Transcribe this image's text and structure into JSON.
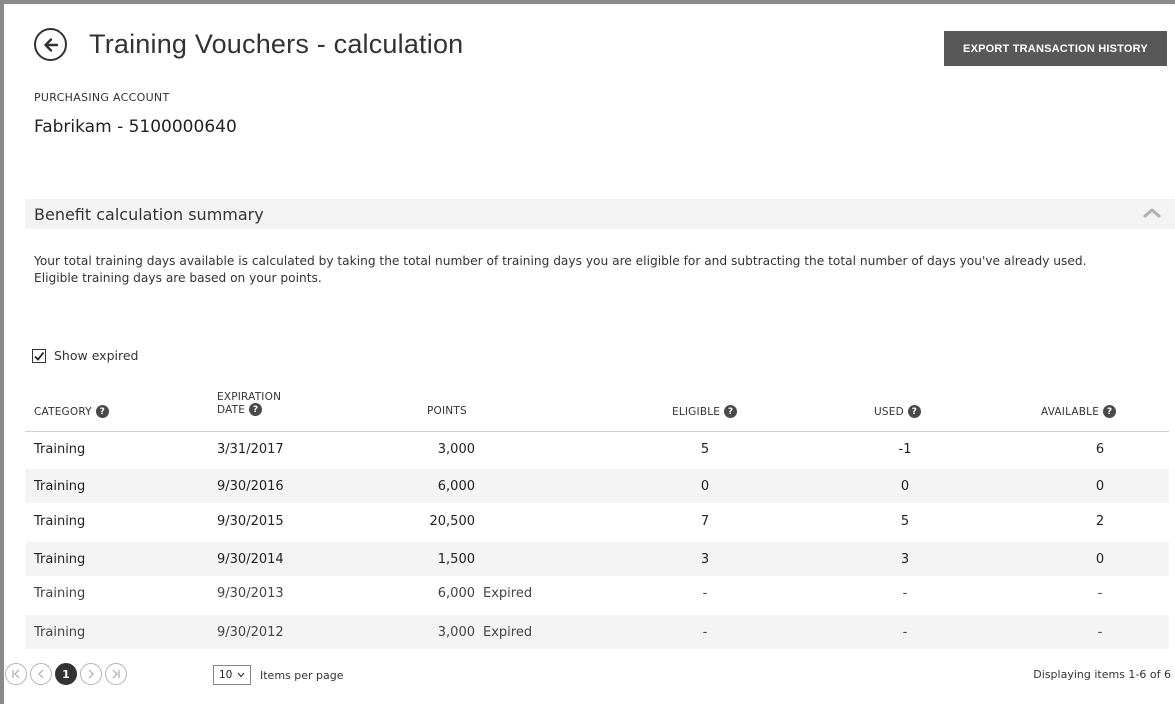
{
  "page": {
    "title": "Training Vouchers - calculation",
    "export_label": "EXPORT TRANSACTION HISTORY"
  },
  "account": {
    "label": "PURCHASING ACCOUNT",
    "value": "Fabrikam - 5100000640"
  },
  "section": {
    "title": "Benefit calculation summary",
    "description_line1": "Your total training days available is calculated by taking the total number of training days you are eligible for and subtracting the total number of days you've already used.",
    "description_line2": "Eligible training days are based on your points."
  },
  "filter": {
    "show_expired_label": "Show expired",
    "show_expired_checked": true
  },
  "table": {
    "headers": {
      "category": "CATEGORY",
      "expiration_line1": "EXPIRATION",
      "expiration_line2": "DATE",
      "points": "POINTS",
      "eligible": "ELIGIBLE",
      "used": "USED",
      "available": "AVAILABLE"
    },
    "rows": [
      {
        "category": "Training",
        "date": "3/31/2017",
        "points": "3,000",
        "status": "",
        "eligible": "5",
        "used": "-1",
        "available": "6"
      },
      {
        "category": "Training",
        "date": "9/30/2016",
        "points": "6,000",
        "status": "",
        "eligible": "0",
        "used": "0",
        "available": "0"
      },
      {
        "category": "Training",
        "date": "9/30/2015",
        "points": "20,500",
        "status": "",
        "eligible": "7",
        "used": "5",
        "available": "2"
      },
      {
        "category": "Training",
        "date": "9/30/2014",
        "points": "1,500",
        "status": "",
        "eligible": "3",
        "used": "3",
        "available": "0"
      },
      {
        "category": "Training",
        "date": "9/30/2013",
        "points": "6,000",
        "status": "Expired",
        "eligible": "-",
        "used": "-",
        "available": "-"
      },
      {
        "category": "Training",
        "date": "9/30/2012",
        "points": "3,000",
        "status": "Expired",
        "eligible": "-",
        "used": "-",
        "available": "-"
      }
    ]
  },
  "pagination": {
    "current_page": "1",
    "items_per_page": "10",
    "items_per_page_label": "Items per page",
    "displaying": "Displaying items 1-6 of 6"
  },
  "icons": {
    "back": "back-arrow-icon",
    "collapse": "chevron-up-icon",
    "help": "question-mark-icon",
    "check": "checkmark-icon"
  }
}
